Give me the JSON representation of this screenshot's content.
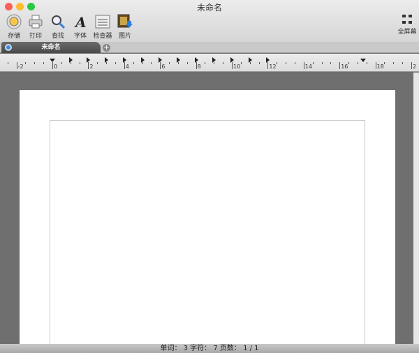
{
  "window": {
    "title": "未命名"
  },
  "toolbar": {
    "save": "存储",
    "print": "打印",
    "find": "查找",
    "font": "字体",
    "inspector": "检查器",
    "image": "图片",
    "fullscreen": "全屏幕"
  },
  "tabs": [
    {
      "label": "未命名"
    }
  ],
  "ruler": {
    "labels": [
      "-2",
      "0",
      "2",
      "4",
      "6",
      "8",
      "10",
      "12",
      "14",
      "16",
      "18",
      "2"
    ]
  },
  "status": {
    "text": "单词： 3  字符： 7  页数： 1 / 1"
  }
}
